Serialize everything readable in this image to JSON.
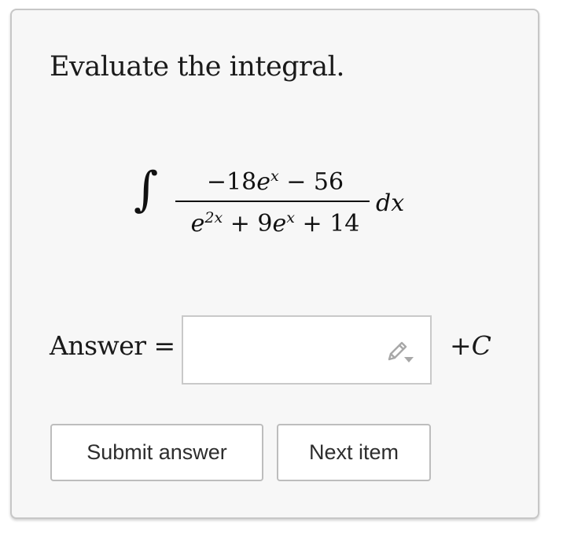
{
  "prompt": "Evaluate the integral.",
  "integral": {
    "sign": "∫",
    "numerator_coef": "−18",
    "numerator_base": "e",
    "numerator_exp": "x",
    "numerator_tail": " − 56",
    "denominator_base1": "e",
    "denominator_exp1": "2x",
    "denominator_mid": " + 9",
    "denominator_base2": "e",
    "denominator_exp2": "x",
    "denominator_tail": " + 14",
    "differential": "dx"
  },
  "answer": {
    "label": "Answer =",
    "value": "",
    "constant_plus": "+",
    "constant_letter": "C",
    "edit_icon": "pencil-icon"
  },
  "buttons": {
    "submit_label": "Submit answer",
    "next_label": "Next item"
  }
}
